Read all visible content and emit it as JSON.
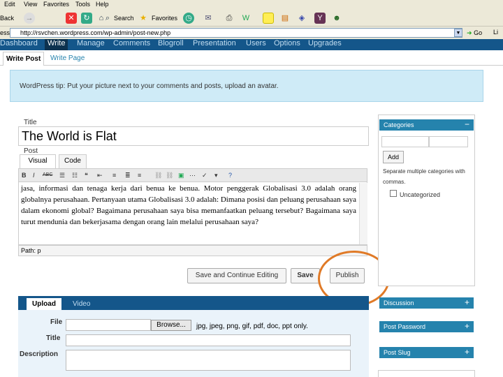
{
  "browser": {
    "menu": [
      "Edit",
      "View",
      "Favorites",
      "Tools",
      "Help"
    ],
    "toolbar": {
      "back_label": "Back",
      "search_label": "Search",
      "favorites_label": "Favorites"
    },
    "address_label": "ess",
    "url": "http://rsvchen.wordpress.com/wp-admin/post-new.php",
    "go_label": "Go",
    "links_label": "Li"
  },
  "wp_nav": {
    "items": [
      "Dashboard",
      "Write",
      "Manage",
      "Comments",
      "Blogroll",
      "Presentation",
      "Users",
      "Options",
      "Upgrades"
    ],
    "subnav": [
      "Write Post",
      "Write Page"
    ]
  },
  "tip": "WordPress tip: Put your picture next to your comments and posts, upload an avatar.",
  "editor": {
    "title_label": "Title",
    "title_value": "The World is Flat",
    "post_label": "Post",
    "tabs": [
      "Visual",
      "Code"
    ],
    "toolbar_labels": [
      "B",
      "I",
      "ABC"
    ],
    "content": "jasa, informasi dan tenaga kerja dari benua ke benua. Motor penggerak Globalisasi 3.0 adalah orang globalnya perusahaan. Pertanyaan utama Globalisasi 3.0 adalah: Dimana posisi dan peluang perusahaan saya dalam ekonomi global? Bagaimana perusahaan saya bisa memanfaatkan peluang tersebut? Bagaimana saya turut mendunia dan bekerjasama dengan orang lain melalui perusahaan saya?",
    "path_label": "Path: p"
  },
  "actions": {
    "save_continue": "Save and Continue Editing",
    "save": "Save",
    "publish": "Publish"
  },
  "upload": {
    "tabs": [
      "Upload",
      "Video"
    ],
    "file_label": "File",
    "browse_label": "Browse...",
    "file_hint": "jpg, jpeg, png, gif, pdf, doc, ppt only.",
    "title_label": "Title",
    "description_label": "Description"
  },
  "sidebar": {
    "categories_title": "Categories",
    "add_label": "Add",
    "help_text": "Separate multiple categories with commas.",
    "uncategorized": "Uncategorized",
    "boxes": [
      "Discussion",
      "Post Password",
      "Post Slug"
    ]
  },
  "colors": {
    "nav_bg": "#14568a",
    "tip_bg": "#cfebf7",
    "sidebar_header": "#2583ad",
    "highlight_circle": "#e07a27"
  }
}
